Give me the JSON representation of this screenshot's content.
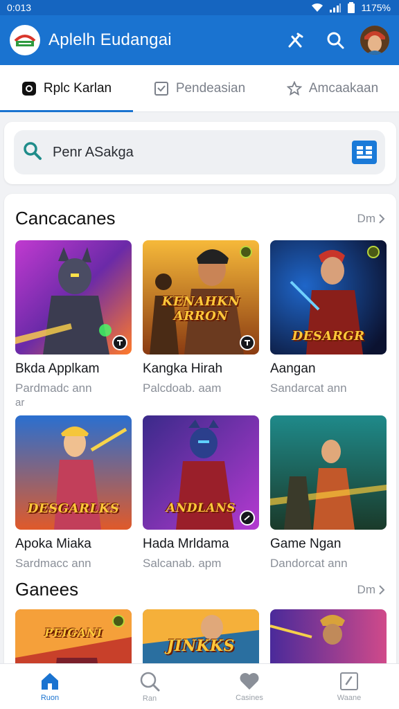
{
  "status": {
    "time": "0:013",
    "battery": "1175%"
  },
  "app_bar": {
    "title": "Aplelh Eudangai"
  },
  "tabs": [
    {
      "label": "Rplc Karlan",
      "active": true
    },
    {
      "label": "Pendeasian",
      "active": false
    },
    {
      "label": "Amcaakaan",
      "active": false
    }
  ],
  "search": {
    "text": "Penr ASakga"
  },
  "sections": [
    {
      "title": "Cancacanes",
      "more": "Dm",
      "items": [
        {
          "title": "Bkda Applkam",
          "subtitle": "Pardmadc ann",
          "extra": "ar"
        },
        {
          "title": "Kangka Hirah",
          "subtitle": "Palcdoab. aam",
          "caption": "KENAHKN ARRON"
        },
        {
          "title": "Aangan",
          "subtitle": "Sandarcat ann",
          "caption": "DESARGR"
        },
        {
          "title": "Apoka Miaka",
          "subtitle": "Sardmacc ann",
          "caption": "DESGARLKS"
        },
        {
          "title": "Hada Mrldama",
          "subtitle": "Salcanab. apm",
          "caption": "ANDLANS"
        },
        {
          "title": "Game Ngan",
          "subtitle": "Dandorcat ann"
        }
      ]
    },
    {
      "title": "Ganees",
      "more": "Dm",
      "items": [
        {
          "caption": "PEIGANI"
        },
        {
          "caption": "JINKKS"
        },
        {
          "caption": ""
        }
      ]
    }
  ],
  "bottom_nav": [
    {
      "label": "Ruon",
      "icon": "home-icon",
      "active": true
    },
    {
      "label": "Ran",
      "icon": "search-icon",
      "active": false
    },
    {
      "label": "Casines",
      "icon": "heart-icon",
      "active": false
    },
    {
      "label": "Waane",
      "icon": "edit-icon",
      "active": false
    }
  ],
  "colors": {
    "primary": "#1a73d0",
    "status_bar": "#1565c0",
    "accent_button": "#1a7ad8"
  }
}
